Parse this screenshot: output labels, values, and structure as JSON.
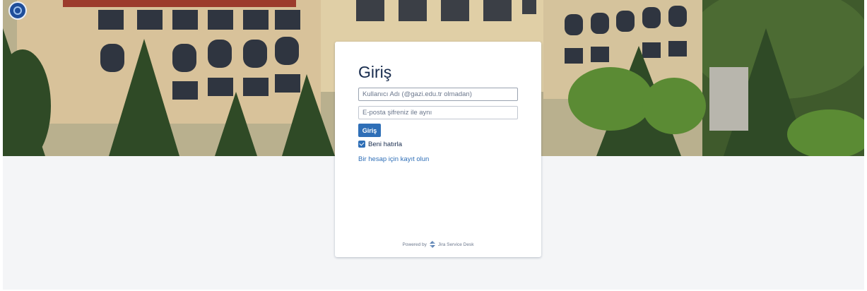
{
  "header": {
    "logo_icon": "university-logo-icon"
  },
  "login": {
    "title": "Giriş",
    "username_placeholder": "Kullanıcı Adı (@gazi.edu.tr olmadan)",
    "password_placeholder": "E-posta şifreniz ile aynı",
    "submit_label": "Giriş",
    "remember_label": "Beni hatırla",
    "remember_checked": true,
    "signup_link": "Bir hesap için kayıt olun"
  },
  "footer": {
    "powered_by": "Powered by",
    "product_name": "Jira Service Desk",
    "product_icon": "jira-service-desk-icon"
  },
  "colors": {
    "accent": "#2f6fb7",
    "page_background": "#f4f5f7",
    "title_text": "#172b4d"
  }
}
